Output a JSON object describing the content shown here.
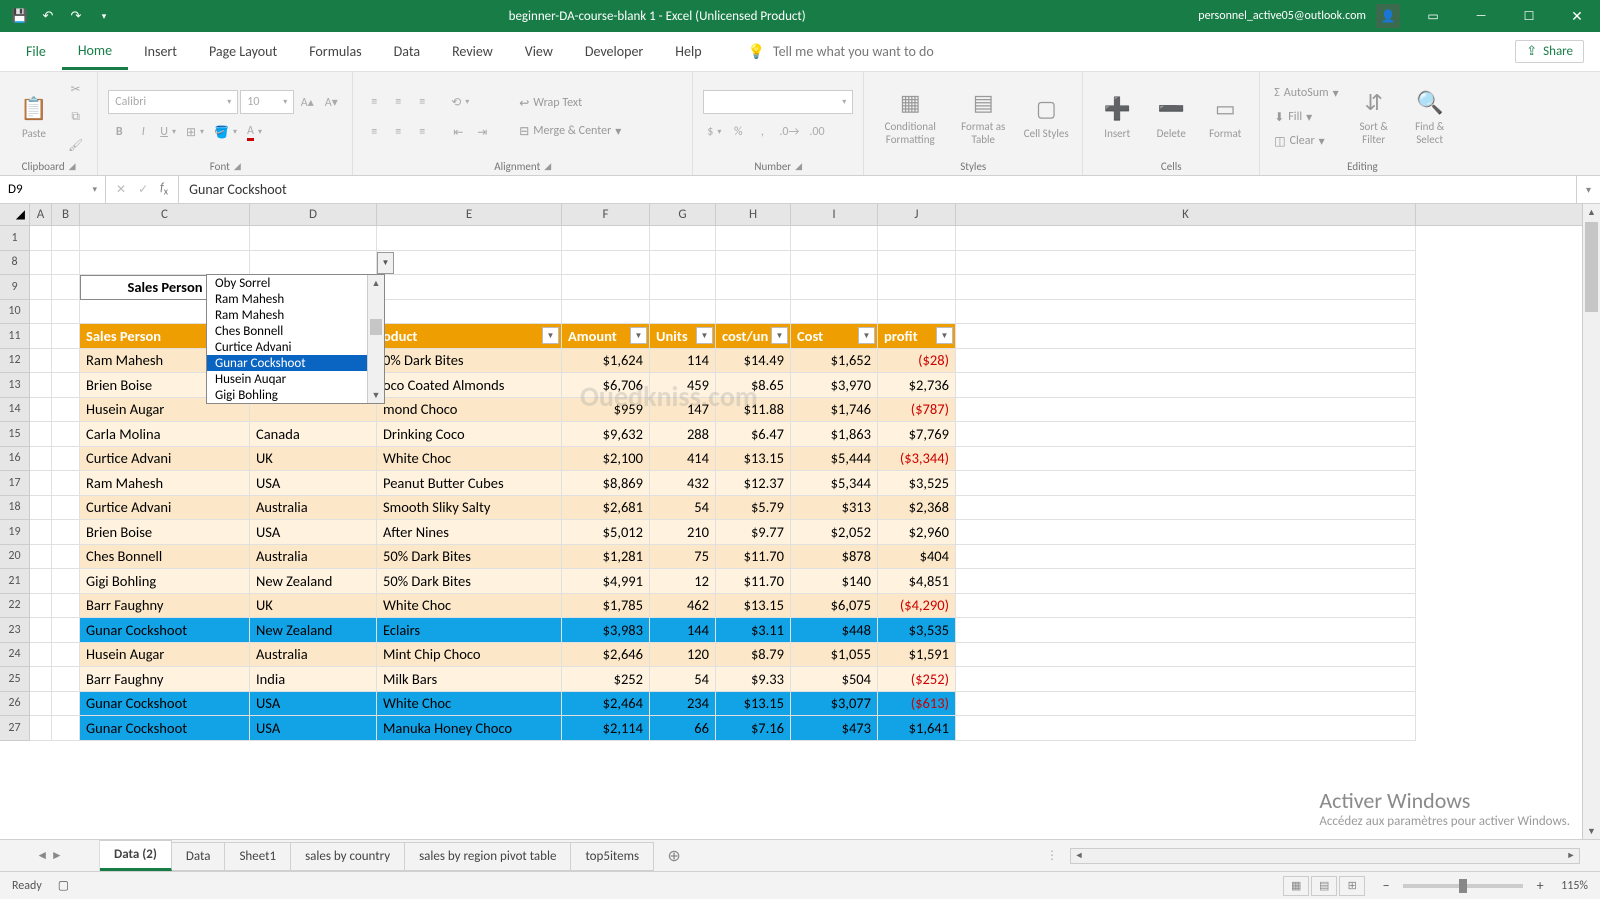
{
  "title": "beginner-DA-course-blank 1 - Excel (Unlicensed Product)",
  "account": "personnel_active05@outlook.com",
  "tabs": {
    "file": "File",
    "home": "Home",
    "insert": "Insert",
    "pagelayout": "Page Layout",
    "formulas": "Formulas",
    "data": "Data",
    "review": "Review",
    "view": "View",
    "developer": "Developer",
    "help": "Help",
    "tellme": "Tell me what you want to do",
    "share": "Share"
  },
  "ribbon": {
    "clipboard": {
      "paste": "Paste",
      "label": "Clipboard"
    },
    "font": {
      "name": "Calibri",
      "size": "10",
      "label": "Font"
    },
    "alignment": {
      "wrap": "Wrap Text",
      "merge": "Merge & Center",
      "label": "Alignment"
    },
    "number": {
      "label": "Number"
    },
    "styles": {
      "cf": "Conditional Formatting",
      "fat": "Format as Table",
      "cs": "Cell Styles",
      "label": "Styles"
    },
    "cells": {
      "ins": "Insert",
      "del": "Delete",
      "fmt": "Format",
      "label": "Cells"
    },
    "editing": {
      "sum": "AutoSum",
      "fill": "Fill",
      "clear": "Clear",
      "sort": "Sort & Filter",
      "find": "Find & Select",
      "label": "Editing"
    }
  },
  "namebox": "D9",
  "formula": "Gunar Cockshoot",
  "colheads": [
    "A",
    "B",
    "C",
    "D",
    "E",
    "F",
    "G",
    "H",
    "I",
    "J",
    "K"
  ],
  "rowheads": [
    "1",
    "8",
    "9",
    "10",
    "11",
    "12",
    "13",
    "14",
    "15",
    "16",
    "17",
    "18",
    "19",
    "20",
    "21",
    "22",
    "23",
    "24",
    "25",
    "26",
    "27"
  ],
  "selector": {
    "label": "Sales Person",
    "value": "Gunar Cockshoot"
  },
  "dropdown": [
    "Oby Sorrel",
    "Ram Mahesh",
    "Ram Mahesh",
    "Ches Bonnell",
    "Curtice Advani",
    "Gunar Cockshoot",
    "Husein Auqar",
    "Gigi Bohling"
  ],
  "headers": [
    "Sales Person",
    "",
    "oduct",
    "Amount",
    "Units",
    "cost/un",
    "Cost",
    "profit"
  ],
  "table": [
    {
      "sp": "Ram Mahesh",
      "geo": "",
      "prod": "0% Dark Bites",
      "amt": "$1,624",
      "units": "114",
      "cpu": "$14.49",
      "cost": "$1,652",
      "profit": "($28)",
      "neg": true,
      "hl": false,
      "band": 0
    },
    {
      "sp": "Brien Boise",
      "geo": "",
      "prod": "oco Coated Almonds",
      "amt": "$6,706",
      "units": "459",
      "cpu": "$8.65",
      "cost": "$3,970",
      "profit": "$2,736",
      "neg": false,
      "hl": false,
      "band": 1
    },
    {
      "sp": "Husein Augar",
      "geo": "",
      "prod": "mond Choco",
      "amt": "$959",
      "units": "147",
      "cpu": "$11.88",
      "cost": "$1,746",
      "profit": "($787)",
      "neg": true,
      "hl": false,
      "band": 0
    },
    {
      "sp": "Carla Molina",
      "geo": "Canada",
      "prod": "Drinking Coco",
      "amt": "$9,632",
      "units": "288",
      "cpu": "$6.47",
      "cost": "$1,863",
      "profit": "$7,769",
      "neg": false,
      "hl": false,
      "band": 1
    },
    {
      "sp": "Curtice Advani",
      "geo": "UK",
      "prod": "White Choc",
      "amt": "$2,100",
      "units": "414",
      "cpu": "$13.15",
      "cost": "$5,444",
      "profit": "($3,344)",
      "neg": true,
      "hl": false,
      "band": 0
    },
    {
      "sp": "Ram Mahesh",
      "geo": "USA",
      "prod": "Peanut Butter Cubes",
      "amt": "$8,869",
      "units": "432",
      "cpu": "$12.37",
      "cost": "$5,344",
      "profit": "$3,525",
      "neg": false,
      "hl": false,
      "band": 1
    },
    {
      "sp": "Curtice Advani",
      "geo": "Australia",
      "prod": "Smooth Sliky Salty",
      "amt": "$2,681",
      "units": "54",
      "cpu": "$5.79",
      "cost": "$313",
      "profit": "$2,368",
      "neg": false,
      "hl": false,
      "band": 0
    },
    {
      "sp": "Brien Boise",
      "geo": "USA",
      "prod": "After Nines",
      "amt": "$5,012",
      "units": "210",
      "cpu": "$9.77",
      "cost": "$2,052",
      "profit": "$2,960",
      "neg": false,
      "hl": false,
      "band": 1
    },
    {
      "sp": "Ches Bonnell",
      "geo": "Australia",
      "prod": "50% Dark Bites",
      "amt": "$1,281",
      "units": "75",
      "cpu": "$11.70",
      "cost": "$878",
      "profit": "$404",
      "neg": false,
      "hl": false,
      "band": 0
    },
    {
      "sp": "Gigi Bohling",
      "geo": "New Zealand",
      "prod": "50% Dark Bites",
      "amt": "$4,991",
      "units": "12",
      "cpu": "$11.70",
      "cost": "$140",
      "profit": "$4,851",
      "neg": false,
      "hl": false,
      "band": 1
    },
    {
      "sp": "Barr Faughny",
      "geo": "UK",
      "prod": "White Choc",
      "amt": "$1,785",
      "units": "462",
      "cpu": "$13.15",
      "cost": "$6,075",
      "profit": "($4,290)",
      "neg": true,
      "hl": false,
      "band": 0
    },
    {
      "sp": "Gunar Cockshoot",
      "geo": "New Zealand",
      "prod": "Eclairs",
      "amt": "$3,983",
      "units": "144",
      "cpu": "$3.11",
      "cost": "$448",
      "profit": "$3,535",
      "neg": false,
      "hl": true,
      "band": 1
    },
    {
      "sp": "Husein Augar",
      "geo": "Australia",
      "prod": "Mint Chip Choco",
      "amt": "$2,646",
      "units": "120",
      "cpu": "$8.79",
      "cost": "$1,055",
      "profit": "$1,591",
      "neg": false,
      "hl": false,
      "band": 0
    },
    {
      "sp": "Barr Faughny",
      "geo": "India",
      "prod": "Milk Bars",
      "amt": "$252",
      "units": "54",
      "cpu": "$9.33",
      "cost": "$504",
      "profit": "($252)",
      "neg": true,
      "hl": false,
      "band": 1
    },
    {
      "sp": "Gunar Cockshoot",
      "geo": "USA",
      "prod": "White Choc",
      "amt": "$2,464",
      "units": "234",
      "cpu": "$13.15",
      "cost": "$3,077",
      "profit": "($613)",
      "neg": true,
      "hl": true,
      "band": 0
    },
    {
      "sp": "Gunar Cockshoot",
      "geo": "USA",
      "prod": "Manuka Honey Choco",
      "amt": "$2,114",
      "units": "66",
      "cpu": "$7.16",
      "cost": "$473",
      "profit": "$1,641",
      "neg": false,
      "hl": true,
      "band": 1
    }
  ],
  "wstabs": [
    "Data (2)",
    "Data",
    "Sheet1",
    "sales by country",
    "sales by region pivot table",
    "top5items"
  ],
  "status": {
    "ready": "Ready",
    "zoom": "115%"
  },
  "watermark": {
    "main": "Ouedkniss.com",
    "activate": "Activer Windows",
    "activate_sub": "Accédez aux paramètres pour activer Windows."
  }
}
